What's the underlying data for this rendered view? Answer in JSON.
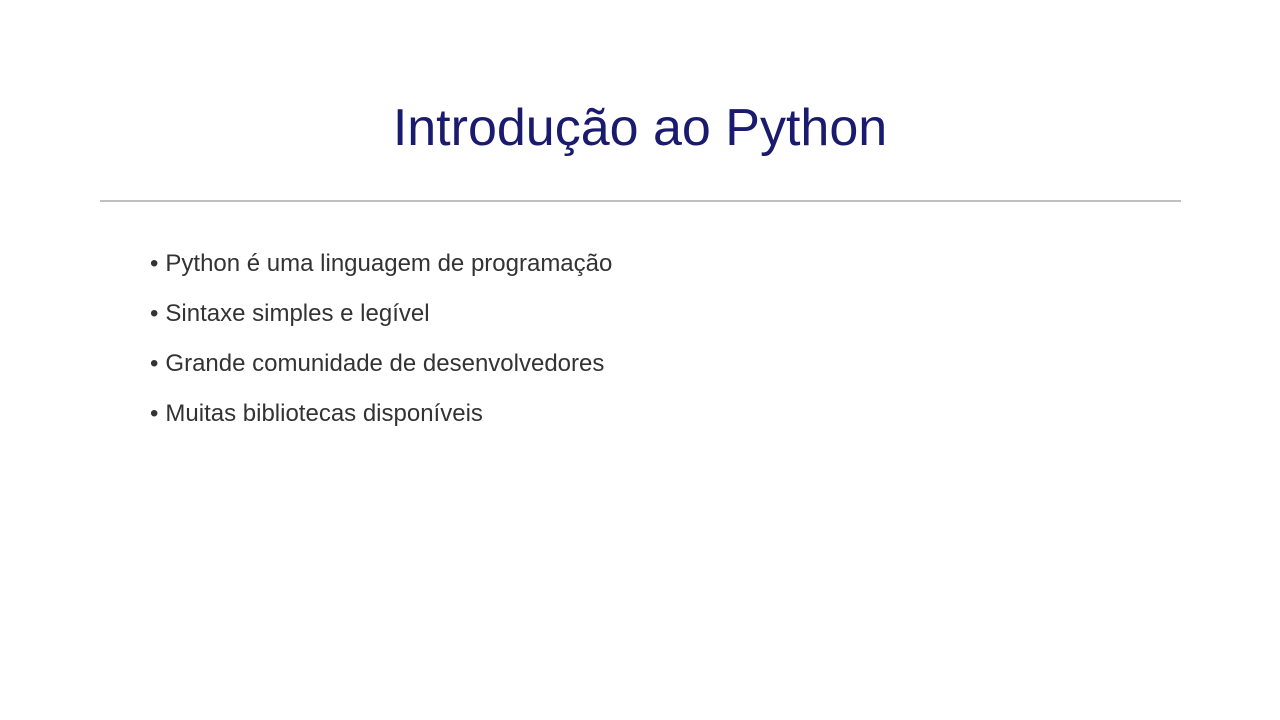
{
  "slide": {
    "title": "Introdução ao Python",
    "bullet_symbol": "•",
    "bullets": [
      "Python é uma linguagem de programação",
      "Sintaxe simples e legível",
      "Grande comunidade de desenvolvedores",
      "Muitas bibliotecas disponíveis"
    ]
  },
  "colors": {
    "title": "#1a1a6e",
    "body_text": "#333333",
    "divider": "#c0c0c0",
    "background": "#ffffff"
  }
}
